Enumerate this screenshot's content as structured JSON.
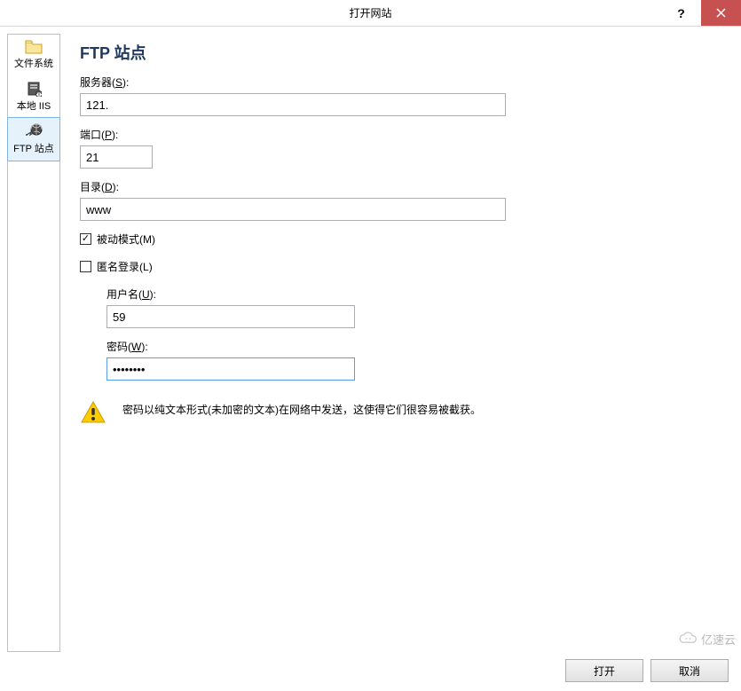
{
  "titlebar": {
    "title": "打开网站",
    "help": "?",
    "close": "×"
  },
  "sidebar": {
    "items": [
      {
        "label": "文件系统"
      },
      {
        "label": "本地 IIS"
      },
      {
        "label": "FTP 站点"
      }
    ]
  },
  "page": {
    "title": "FTP 站点"
  },
  "form": {
    "server_label_prefix": "服务器(",
    "server_label_key": "S",
    "server_label_suffix": "):",
    "server_value": "121.",
    "port_label_prefix": "端口(",
    "port_label_key": "P",
    "port_label_suffix": "):",
    "port_value": "21",
    "dir_label_prefix": "目录(",
    "dir_label_key": "D",
    "dir_label_suffix": "):",
    "dir_value": "www",
    "passive_prefix": "被动模式(",
    "passive_key": "M",
    "passive_suffix": ")",
    "anon_prefix": "匿名登录(",
    "anon_key": "L",
    "anon_suffix": ")",
    "user_label_prefix": "用户名(",
    "user_label_key": "U",
    "user_label_suffix": "):",
    "user_value": "59",
    "pass_label_prefix": "密码(",
    "pass_label_key": "W",
    "pass_label_suffix": "):",
    "pass_value": "••••••••",
    "warning_text": "密码以纯文本形式(未加密的文本)在网络中发送，这使得它们很容易被截获。"
  },
  "buttons": {
    "open": "打开",
    "cancel": "取消"
  },
  "watermark": {
    "text": "亿速云"
  }
}
